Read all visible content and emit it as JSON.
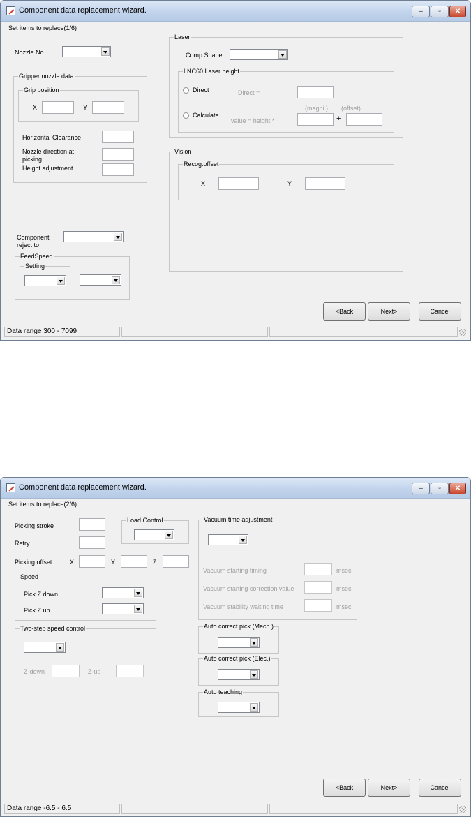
{
  "window1": {
    "title": "Component data replacement wizard.",
    "caption_buttons": {
      "minimize": "–",
      "maximize": "▫",
      "close": "✕"
    },
    "step": "Set items to replace(1/6)",
    "nozzle_no_label": "Nozzle No.",
    "gripper": {
      "title": "Gripper nozzle data",
      "grip_position_title": "Grip position",
      "x_label": "X",
      "y_label": "Y",
      "horizontal_clearance_label": "Horizontal Clearance",
      "nozzle_direction_label": "Nozzle direction at picking",
      "height_adjustment_label": "Height adjustment"
    },
    "component_reject_label": "Component reject to",
    "feedspeed": {
      "title": "FeedSpeed",
      "setting_title": "Setting"
    },
    "laser": {
      "title": "Laser",
      "comp_shape_label": "Comp Shape",
      "lnc_title": "LNC60 Laser height",
      "direct_label": "Direct",
      "direct_eq": "Direct =",
      "calculate_label": "Calculate",
      "formula_label": "value = height *",
      "magni_label": "(magni.)",
      "offset_label": "(offset)",
      "plus": "+"
    },
    "vision": {
      "title": "Vision",
      "recog_offset_title": "Recog.offset",
      "x_label": "X",
      "y_label": "Y"
    },
    "buttons": {
      "back": "<Back",
      "next": "Next>",
      "cancel": "Cancel"
    },
    "status": "Data range  300 - 7099"
  },
  "window2": {
    "title": "Component data replacement wizard.",
    "caption_buttons": {
      "minimize": "–",
      "maximize": "▫",
      "close": "✕"
    },
    "step": "Set items to replace(2/6)",
    "picking_stroke_label": "Picking stroke",
    "retry_label": "Retry",
    "picking_offset_label": "Picking offset",
    "x_label": "X",
    "y_label": "Y",
    "z_label": "Z",
    "load_control_title": "Load Control",
    "speed": {
      "title": "Speed",
      "pick_z_down": "Pick Z down",
      "pick_z_up": "Pick Z up"
    },
    "two_step": {
      "title": "Two-step speed control",
      "z_down": "Z-down",
      "z_up": "Z-up"
    },
    "vacuum": {
      "title": "Vacuum time adjustment",
      "starting_timing": "Vacuum starting timing",
      "starting_correction": "Vacuum starting correction value",
      "stability_waiting": "Vacuum stability waiting time",
      "unit": "msec"
    },
    "auto_mech_title": "Auto correct pick (Mech.)",
    "auto_elec_title": "Auto correct pick (Elec.)",
    "auto_teaching_title": "Auto teaching",
    "buttons": {
      "back": "<Back",
      "next": "Next>",
      "cancel": "Cancel"
    },
    "status": "Data range  -6.5 - 6.5"
  }
}
